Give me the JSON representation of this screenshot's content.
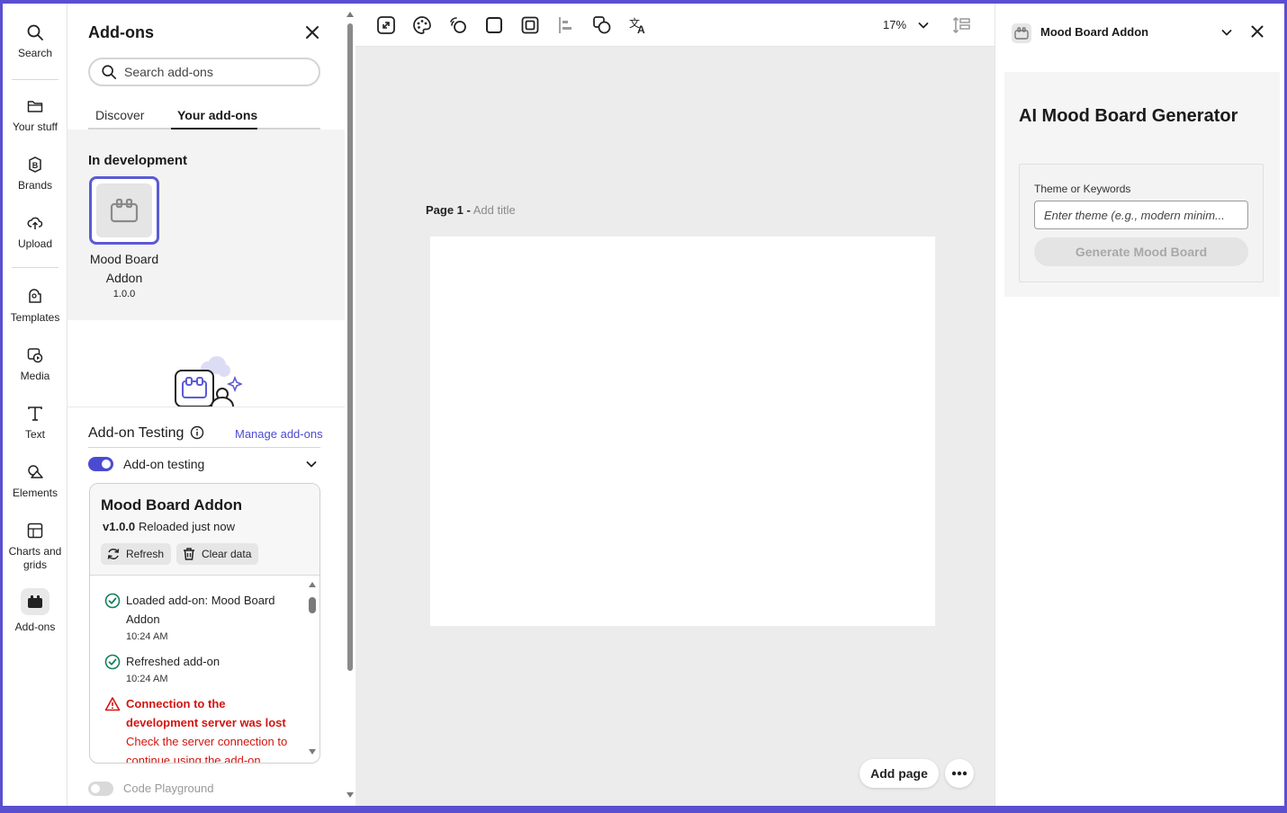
{
  "rail": {
    "items": [
      {
        "id": "search",
        "label": "Search",
        "icon": "search-icon"
      },
      {
        "id": "your-stuff",
        "label": "Your stuff",
        "icon": "folder-icon"
      },
      {
        "id": "brands",
        "label": "Brands",
        "icon": "brand-icon"
      },
      {
        "id": "upload",
        "label": "Upload",
        "icon": "upload-cloud-icon"
      },
      {
        "id": "templates",
        "label": "Templates",
        "icon": "templates-icon"
      },
      {
        "id": "media",
        "label": "Media",
        "icon": "media-icon"
      },
      {
        "id": "text",
        "label": "Text",
        "icon": "text-icon"
      },
      {
        "id": "elements",
        "label": "Elements",
        "icon": "shapes-icon"
      },
      {
        "id": "charts",
        "label": "Charts and grids",
        "icon": "grid-icon"
      },
      {
        "id": "addons",
        "label": "Add-ons",
        "icon": "addons-icon",
        "active": true
      }
    ]
  },
  "panel": {
    "title": "Add-ons",
    "search_placeholder": "Search add-ons",
    "tabs": [
      {
        "label": "Discover",
        "active": false
      },
      {
        "label": "Your add-ons",
        "active": true
      }
    ],
    "dev_section_title": "In development",
    "addon": {
      "name": "Mood Board Addon",
      "version": "1.0.0"
    }
  },
  "testing": {
    "title": "Add-on Testing",
    "manage_link": "Manage add-ons",
    "toggle_label": "Add-on testing",
    "toggle_on": true,
    "card": {
      "title": "Mood Board Addon",
      "version": "v1.0.0",
      "status": "Reloaded just now",
      "refresh_label": "Refresh",
      "clear_label": "Clear data"
    },
    "log": [
      {
        "type": "success",
        "text": "Loaded add-on: Mood Board Addon",
        "time": "10:24 AM"
      },
      {
        "type": "success",
        "text": "Refreshed add-on",
        "time": "10:24 AM"
      },
      {
        "type": "error",
        "title": "Connection to the development server was lost",
        "detail": "Check the server connection to continue using the add-on"
      }
    ],
    "playground_label": "Code Playground",
    "playground_on": false
  },
  "canvas": {
    "zoom": "17%",
    "page_number": "Page 1 -",
    "page_title_placeholder": "Add title",
    "add_page_label": "Add page"
  },
  "right_panel": {
    "title": "Mood Board Addon",
    "heading": "AI Mood Board Generator",
    "theme_label": "Theme or Keywords",
    "theme_placeholder": "Enter theme (e.g., modern minim...",
    "generate_label": "Generate Mood Board"
  },
  "colors": {
    "accent": "#4b4bd1",
    "error": "#d31510",
    "success": "#12805c",
    "frame": "#5a4fcf"
  }
}
